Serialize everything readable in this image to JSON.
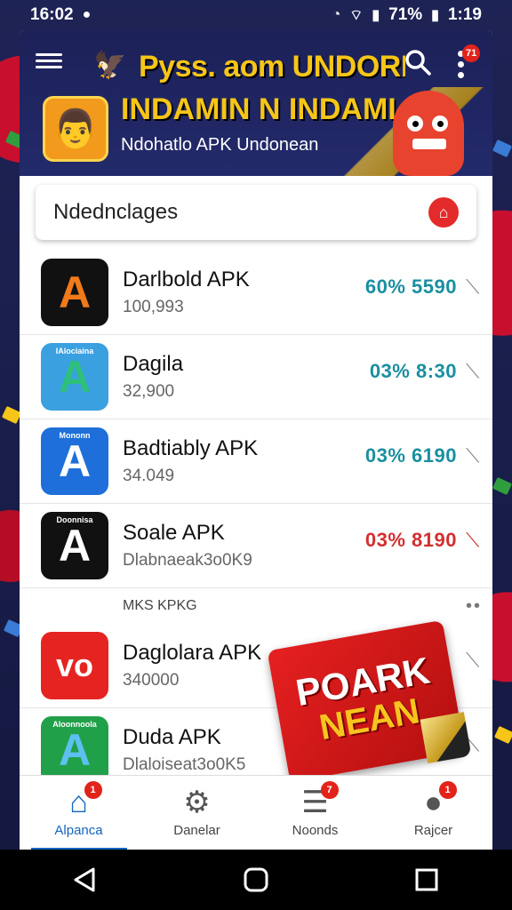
{
  "status_bar": {
    "time": "16:02",
    "battery_pct": "71%",
    "clock_right": "1:19"
  },
  "header": {
    "title": "Pyss. aom UNDORM",
    "subtitle": "INDAMIN N INDAMI",
    "tagline": "Ndohatlo APK Undonean",
    "more_badge": "71"
  },
  "search": {
    "placeholder": "Ndednclages"
  },
  "apps": [
    {
      "name": "Darlbold APK",
      "count": "100,993",
      "meta": "60% 5590",
      "meta_color": "#1a8fa0",
      "icon_bg": "#111111",
      "icon_fg": "#f07a1a",
      "icon_glyph": "A",
      "icon_mini": ""
    },
    {
      "name": "Dagila",
      "count": "32,900",
      "meta": "03% 8:30",
      "meta_color": "#1a8fa0",
      "icon_bg": "#3aa0e0",
      "icon_fg": "#2ec07a",
      "icon_glyph": "A",
      "icon_mini": "IAlociaina"
    },
    {
      "name": "Badtiably APK",
      "count": "34.049",
      "meta": "03% 6190",
      "meta_color": "#1a8fa0",
      "icon_bg": "#1e6fd9",
      "icon_fg": "#ffffff",
      "icon_glyph": "A",
      "icon_mini": "Mononn"
    },
    {
      "name": "Soale APK",
      "count": "Dlabnaeak3o0K9",
      "meta": "03% 8190",
      "meta_color": "#d32f2f",
      "icon_bg": "#111111",
      "icon_fg": "#ffffff",
      "icon_glyph": "A",
      "icon_mini": "Doonnisa"
    }
  ],
  "section": {
    "label": "MKS KPKG",
    "more": "••"
  },
  "apps2": [
    {
      "name": "Daglolara APK",
      "count": "340000",
      "icon_bg": "#e52421",
      "icon_fg": "#ffffff",
      "icon_glyph": "vo",
      "icon_mini": ""
    },
    {
      "name": "Duda APK",
      "count": "Dlaloiseat3o0K5",
      "icon_bg": "#21a04a",
      "icon_fg": "#5ec0f0",
      "icon_glyph": "A",
      "icon_mini": "Aloonnoola"
    }
  ],
  "promo": {
    "line1": "POARK",
    "line2": "NEAN"
  },
  "bottom_nav": [
    {
      "label": "Alpanca",
      "icon": "home-icon",
      "badge": "1",
      "active": true
    },
    {
      "label": "Danelar",
      "icon": "gear-icon",
      "badge": "",
      "active": false
    },
    {
      "label": "Noonds",
      "icon": "stack-icon",
      "badge": "7",
      "active": false
    },
    {
      "label": "Rajcer",
      "icon": "user-icon",
      "badge": "1",
      "active": false
    }
  ]
}
